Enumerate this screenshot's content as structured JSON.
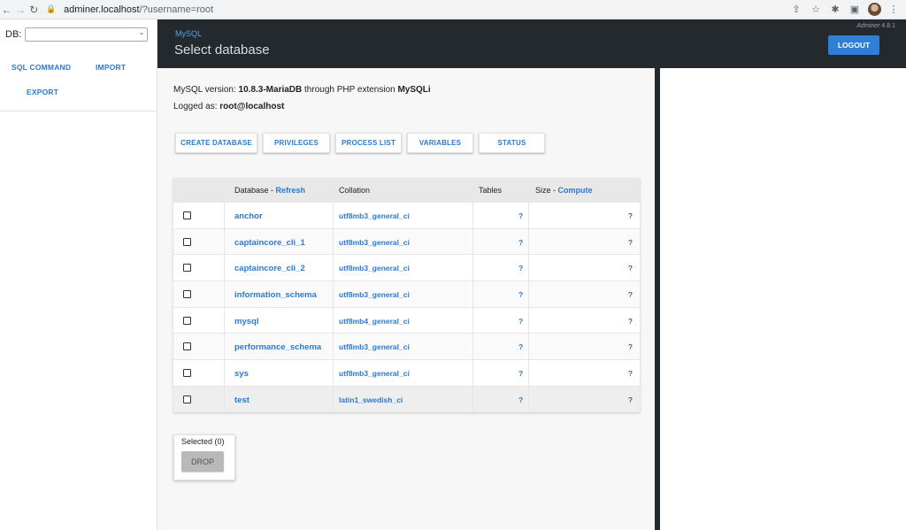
{
  "browser": {
    "back_icon": "←",
    "forward_icon": "→",
    "reload_icon": "↻",
    "lock_icon": "🔒",
    "url_host": "adminer.localhost",
    "url_path": "/?username=root",
    "share_icon": "⇪",
    "star_icon": "☆",
    "extensions_icon": "✱",
    "sidepanel_icon": "▣",
    "menu_icon": "⋮"
  },
  "sidebar": {
    "db_label": "DB:",
    "db_value": "",
    "chevron": "⌄",
    "links": {
      "sql_command": "SQL COMMAND",
      "import": "IMPORT",
      "export": "EXPORT"
    }
  },
  "header": {
    "brand": "MySQL",
    "title": "Select database",
    "version_name": "Adminer",
    "version_number": "4.8.1",
    "logout": "LOGOUT"
  },
  "info": {
    "version_prefix": "MySQL version: ",
    "version": "10.8.3-MariaDB",
    "version_mid": " through PHP extension ",
    "extension": "MySQLi",
    "logged_prefix": "Logged as: ",
    "logged_user": "root@localhost"
  },
  "buttons": {
    "create_database": "CREATE DATABASE",
    "privileges": "PRIVILEGES",
    "process_list": "PROCESS LIST",
    "variables": "VARIABLES",
    "status": "STATUS"
  },
  "table": {
    "headers": {
      "database": "Database - ",
      "refresh": "Refresh",
      "collation": "Collation",
      "tables": "Tables",
      "size": "Size - ",
      "compute": "Compute"
    },
    "rows": [
      {
        "name": "anchor",
        "collation": "utf8mb3_general_ci",
        "tables": "?",
        "size": "?"
      },
      {
        "name": "captaincore_cli_1",
        "collation": "utf8mb3_general_ci",
        "tables": "?",
        "size": "?"
      },
      {
        "name": "captaincore_cli_2",
        "collation": "utf8mb3_general_ci",
        "tables": "?",
        "size": "?"
      },
      {
        "name": "information_schema",
        "collation": "utf8mb3_general_ci",
        "tables": "?",
        "size": "?"
      },
      {
        "name": "mysql",
        "collation": "utf8mb4_general_ci",
        "tables": "?",
        "size": "?"
      },
      {
        "name": "performance_schema",
        "collation": "utf8mb3_general_ci",
        "tables": "?",
        "size": "?"
      },
      {
        "name": "sys",
        "collation": "utf8mb3_general_ci",
        "tables": "?",
        "size": "?"
      },
      {
        "name": "test",
        "collation": "latin1_swedish_ci",
        "tables": "?",
        "size": "?"
      }
    ]
  },
  "selection": {
    "legend": "Selected (0)",
    "drop": "DROP"
  },
  "colors": {
    "accent": "#2a7ad1",
    "header_bg": "#24292e",
    "logout_bg": "#2f7fd6"
  }
}
